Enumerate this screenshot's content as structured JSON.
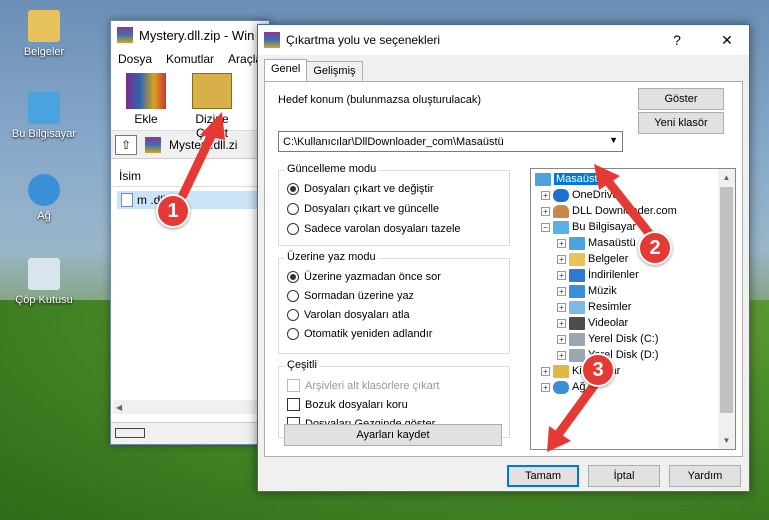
{
  "desktop": {
    "icons": [
      {
        "label": "Belgeler",
        "icon": "documents-folder-icon",
        "color": "#e8c25a"
      },
      {
        "label": "Bu Bilgisayar",
        "icon": "computer-icon",
        "color": "#4aa3df"
      },
      {
        "label": "Ağ",
        "icon": "network-icon",
        "color": "#3b8fd6"
      },
      {
        "label": "Çöp Kutusu",
        "icon": "recycle-bin-icon",
        "color": "#d8e4ee"
      }
    ]
  },
  "winrar": {
    "title": "Mystery.dll.zip - Win",
    "menu": [
      "Dosya",
      "Komutlar",
      "Araçla"
    ],
    "toolbar": {
      "add_label": "Ekle",
      "extract_label": "Dizine Çıkart"
    },
    "address": "Mystery.dll.zi",
    "column_name": "İsim",
    "file_name": "m         .dll"
  },
  "dialog": {
    "title": "Çıkartma yolu ve seçenekleri",
    "tabs": [
      "Genel",
      "Gelişmiş"
    ],
    "dest_label": "Hedef konum (bulunmazsa oluşturulacak)",
    "dest_value": "C:\\Kullanıcılar\\DllDownloader_com\\Masaüstü",
    "show_button": "Göster",
    "new_folder_button": "Yeni klasör",
    "update_mode": {
      "title": "Güncelleme modu",
      "options": [
        "Dosyaları çıkart ve değiştir",
        "Dosyaları çıkart ve güncelle",
        "Sadece varolan dosyaları tazele"
      ],
      "selected": 0
    },
    "overwrite_mode": {
      "title": "Üzerine yaz modu",
      "options": [
        "Üzerine yazmadan önce sor",
        "Sormadan üzerine yaz",
        "Varolan dosyaları atla",
        "Otomatik yeniden adlandır"
      ],
      "selected": 0
    },
    "misc": {
      "title": "Çeşitli",
      "options": [
        "Arşivleri alt klasörlere çıkart",
        "Bozuk dosyaları koru",
        "Dosyaları Gezginde göster"
      ]
    },
    "save_settings_button": "Ayarları kaydet",
    "tree": [
      {
        "label": "Masaüstü",
        "level": 0,
        "selected": true,
        "icon": "desktop-icon"
      },
      {
        "label": "OneDrive",
        "level": 1,
        "icon": "onedrive-icon"
      },
      {
        "label": "DLL Downloader.com",
        "level": 1,
        "icon": "user-icon"
      },
      {
        "label": "Bu Bilgisayar",
        "level": 1,
        "icon": "computer-icon"
      },
      {
        "label": "Masaüstü",
        "level": 2,
        "icon": "desktop-icon"
      },
      {
        "label": "Belgeler",
        "level": 2,
        "icon": "documents-icon"
      },
      {
        "label": "İndirilenler",
        "level": 2,
        "icon": "downloads-icon"
      },
      {
        "label": "Müzik",
        "level": 2,
        "icon": "music-icon"
      },
      {
        "label": "Resimler",
        "level": 2,
        "icon": "pictures-icon"
      },
      {
        "label": "Videolar",
        "level": 2,
        "icon": "videos-icon"
      },
      {
        "label": "Yerel Disk (C:)",
        "level": 2,
        "icon": "disk-icon"
      },
      {
        "label": "Yerel Disk (D:)",
        "level": 2,
        "icon": "disk-icon"
      },
      {
        "label": "Kitaplıklar",
        "level": 1,
        "icon": "libraries-icon"
      },
      {
        "label": "Ağ",
        "level": 1,
        "icon": "network-icon"
      }
    ],
    "ok_button": "Tamam",
    "cancel_button": "İptal",
    "help_button": "Yardım"
  },
  "annotations": {
    "step1": "1",
    "step2": "2",
    "step3": "3",
    "color": "#e53935"
  }
}
